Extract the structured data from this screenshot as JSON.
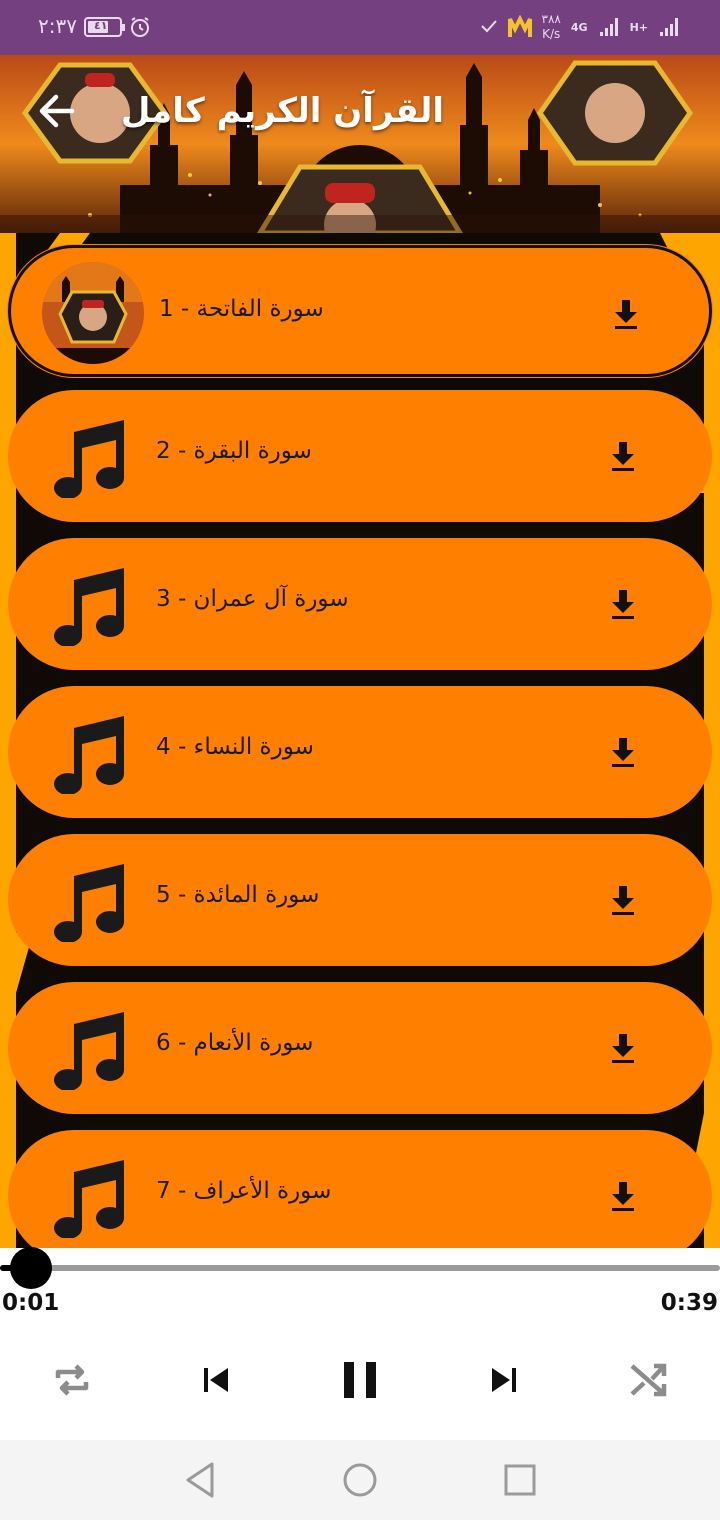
{
  "status_bar": {
    "time": "٢:٣٧",
    "battery": "٤١",
    "speed_value": "٣٨٨",
    "speed_unit": "K/s",
    "network_1": "4G",
    "network_2": "H+"
  },
  "header": {
    "title": "القرآن الكريم كامل"
  },
  "tracks": [
    {
      "label": "سورة الفاتحة - 1",
      "active": true
    },
    {
      "label": "سورة البقرة - 2",
      "active": false
    },
    {
      "label": "سورة آل عمران - 3",
      "active": false
    },
    {
      "label": "سورة النساء - 4",
      "active": false
    },
    {
      "label": "سورة المائدة - 5",
      "active": false
    },
    {
      "label": "سورة الأنعام - 6",
      "active": false
    },
    {
      "label": "سورة الأعراف - 7",
      "active": false
    }
  ],
  "player": {
    "current_time": "0:01",
    "total_time": "0:39",
    "progress": 0.026
  },
  "colors": {
    "status_bar": "#74407f",
    "item_fill": "#ff7f00",
    "list_background": "#ffa500"
  },
  "icons": {
    "back": "arrow-left-icon",
    "download": "download-icon",
    "track": "music-note-icon",
    "repeat": "repeat-icon",
    "previous": "skip-previous-icon",
    "play_pause": "pause-icon",
    "next": "skip-next-icon",
    "shuffle": "shuffle-icon"
  }
}
